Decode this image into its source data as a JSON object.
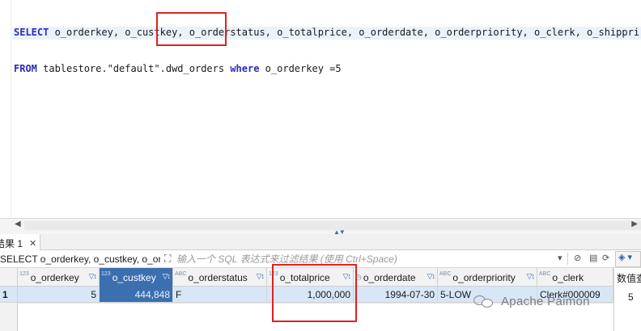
{
  "editor": {
    "line1": {
      "kw_select": "SELECT",
      "text": " o_orderkey, o_custkey, o_orderstatus, o_totalprice, o_orderdate, o_orderpriority, o_clerk, o_shippri"
    },
    "line2": {
      "kw_from": "FROM",
      "pre": " tablestore.\"default\".dwd_orders ",
      "kw_where": "where",
      "post": " o_orderkey =5"
    }
  },
  "results": {
    "tab_label": "结果 1",
    "tab_close": "✕",
    "query_preview": "SELECT o_orderkey, o_custkey, o_orc",
    "filter_placeholder": "输入一个 SQL 表达式来过滤结果 (使用 Ctrl+Space)",
    "side_panel_title": "数值查",
    "side_panel_value": "5",
    "columns": [
      {
        "name": "o_orderkey",
        "type": "123"
      },
      {
        "name": "o_custkey",
        "type": "123"
      },
      {
        "name": "o_orderstatus",
        "type": "ABC"
      },
      {
        "name": "o_totalprice",
        "type": "123"
      },
      {
        "name": "o_orderdate",
        "type": "◷"
      },
      {
        "name": "o_orderpriority",
        "type": "ABC"
      },
      {
        "name": "o_clerk",
        "type": "ABC"
      }
    ],
    "rows": [
      {
        "rownum": "1",
        "o_orderkey": "5",
        "o_custkey": "444,848",
        "o_orderstatus": "F",
        "o_totalprice": "1,000,000",
        "o_orderdate": "1994-07-30",
        "o_orderpriority": "5-LOW",
        "o_clerk": "Clerk#000009"
      }
    ]
  },
  "watermark": "Apache Paimon",
  "colors": {
    "highlight_box": "#e02020",
    "selection": "#3b6fb0",
    "row_bg": "#d7e7f8"
  }
}
